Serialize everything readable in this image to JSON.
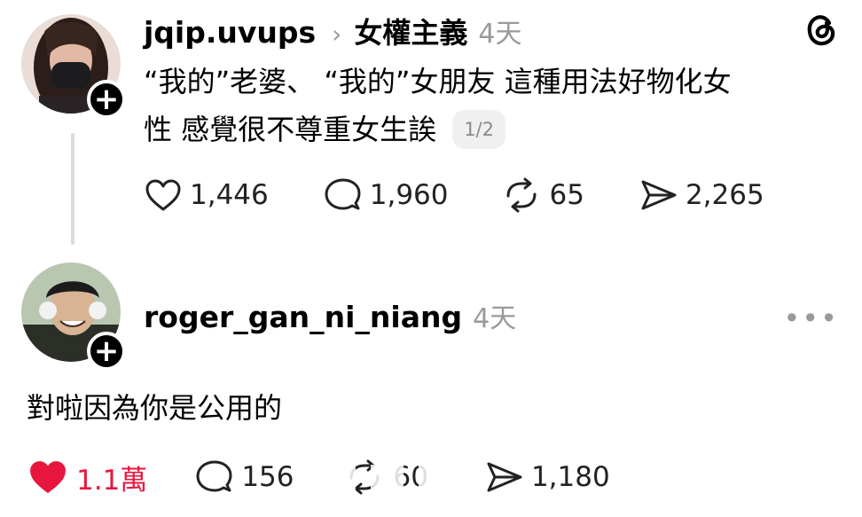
{
  "post": {
    "username": "jqip.uvups",
    "chevron": "›",
    "topic": "女權主義",
    "time": "4天",
    "text_line1": "“我的”老婆、 “我的”女朋友 這種用法好物化女",
    "text_line2": "性 感覺很不尊重女生誒",
    "page_badge": "1/2",
    "likes": "1,446",
    "comments": "1,960",
    "reposts": "65",
    "shares": "2,265",
    "follow_symbol": "+"
  },
  "reply": {
    "username": "roger_gan_ni_niang",
    "time": "4天",
    "more": "•••",
    "text": "對啦因為你是公用的",
    "likes": "1.1萬",
    "comments": "156",
    "reposts": "60",
    "shares": "1,180",
    "follow_symbol": "+"
  },
  "icons": {
    "app_logo": "threads-logo-icon",
    "like": "heart-icon",
    "like_active": "heart-filled-icon",
    "comment": "comment-bubble-icon",
    "repost": "repost-icon",
    "share": "send-icon"
  },
  "colors": {
    "like_active": "#e8163f",
    "muted": "#9a9a9a",
    "thread_line": "#dcdcdc"
  }
}
